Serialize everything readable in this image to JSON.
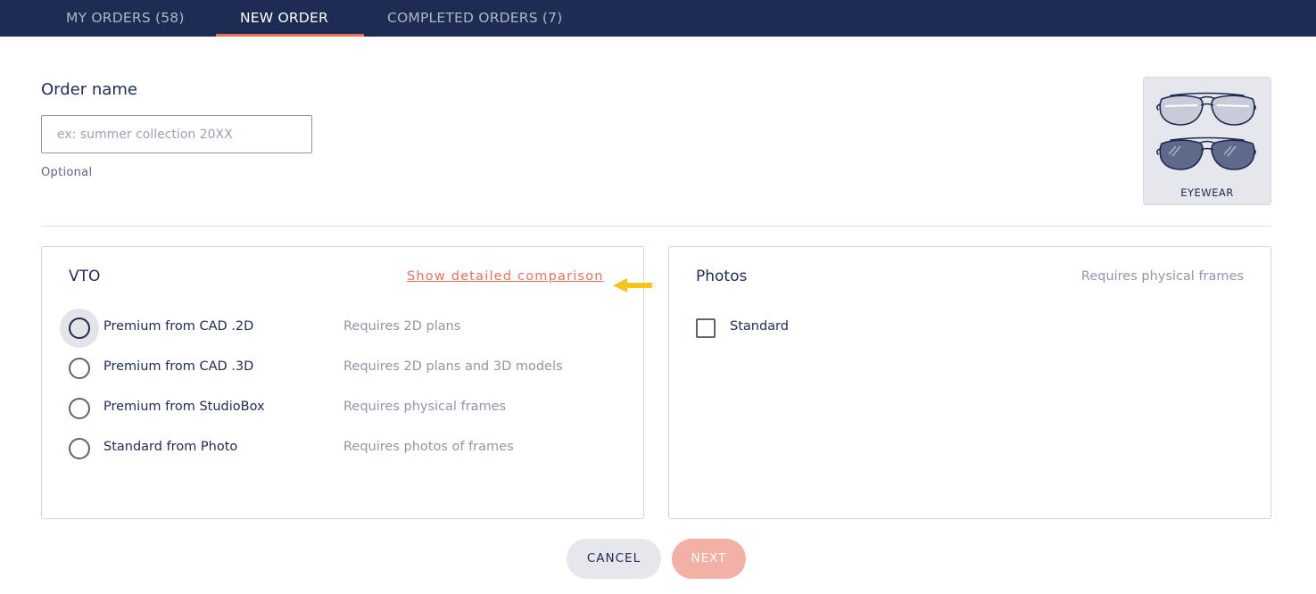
{
  "tabs": [
    {
      "label": "MY ORDERS (58)",
      "active": false
    },
    {
      "label": "NEW ORDER",
      "active": true
    },
    {
      "label": "COMPLETED ORDERS (7)",
      "active": false
    }
  ],
  "order": {
    "label": "Order name",
    "placeholder": "ex: summer collection 20XX",
    "value": "",
    "hint": "Optional"
  },
  "category": {
    "label": "EYEWEAR",
    "icon": "aviator-sunglasses-icon"
  },
  "vto": {
    "title": "VTO",
    "compare_link": "Show detailed comparison",
    "options": [
      {
        "label": "Premium from CAD .2D",
        "requirement": "Requires 2D plans",
        "selected": false,
        "focused": true
      },
      {
        "label": "Premium from CAD .3D",
        "requirement": "Requires 2D plans and 3D models",
        "selected": false,
        "focused": false
      },
      {
        "label": "Premium from StudioBox",
        "requirement": "Requires physical frames",
        "selected": false,
        "focused": false
      },
      {
        "label": "Standard from Photo",
        "requirement": "Requires photos of frames",
        "selected": false,
        "focused": false
      }
    ]
  },
  "photos": {
    "title": "Photos",
    "requirement": "Requires physical frames",
    "options": [
      {
        "label": "Standard",
        "checked": false
      }
    ]
  },
  "actions": {
    "cancel": "CANCEL",
    "next": "NEXT",
    "next_enabled": false
  },
  "colors": {
    "navy": "#1e2b52",
    "accent": "#e8705c",
    "next_disabled": "#f3b0a4",
    "annotation_arrow": "#f5c518"
  }
}
